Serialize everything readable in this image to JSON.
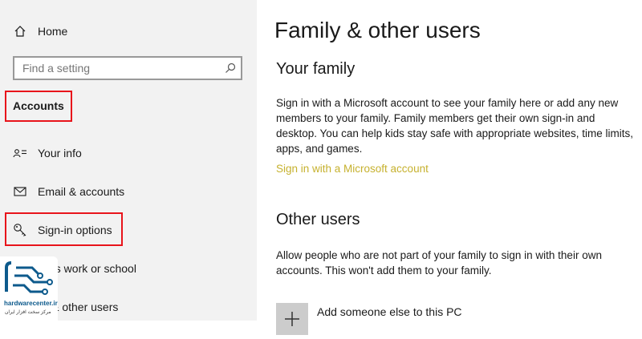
{
  "sidebar": {
    "home_label": "Home",
    "search_placeholder": "Find a setting",
    "section_heading": "Accounts",
    "items": [
      {
        "label": "Your info",
        "icon": "contact-card-icon"
      },
      {
        "label": "Email & accounts",
        "icon": "mail-icon"
      },
      {
        "label": "Sign-in options",
        "icon": "key-icon"
      },
      {
        "label": "cess work or school",
        "icon": "briefcase-icon"
      },
      {
        "label": "ily & other users",
        "icon": "people-icon"
      }
    ]
  },
  "main": {
    "title": "Family & other users",
    "your_family": {
      "heading": "Your family",
      "description": "Sign in with a Microsoft account to see your family here or add any new members to your family. Family members get their own sign-in and desktop. You can help kids stay safe with appropriate websites, time limits, apps, and games.",
      "link_label": "Sign in with a Microsoft account"
    },
    "other_users": {
      "heading": "Other users",
      "description": "Allow people who are not part of your family to sign in with their own accounts. This won't add them to your family.",
      "add_label": "Add someone else to this PC"
    }
  },
  "watermark": {
    "brand": "hardwarecenter.ir",
    "tagline": "مرکز سخت افزار ایران"
  },
  "colors": {
    "sidebar_bg": "#f2f2f2",
    "link": "#c6b12e",
    "highlight": "#e8141b",
    "logo_blue": "#0d5a8c"
  }
}
